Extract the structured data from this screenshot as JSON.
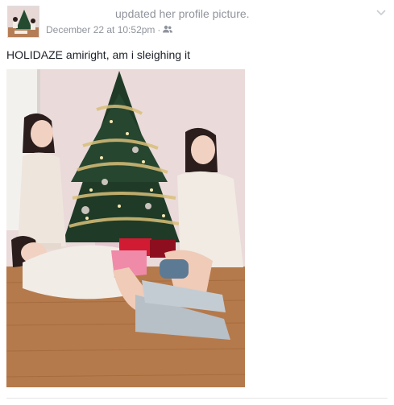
{
  "post": {
    "headline": "updated her profile picture.",
    "timestamp": "December 22 at 10:52pm",
    "separator": "·",
    "privacy_icon": "friends-icon",
    "menu_icon": "chevron-down-icon",
    "status_text": "HOLIDAZE amiright, am i sleighing it"
  },
  "colors": {
    "meta_gray": "#90949c",
    "text": "#1d2129",
    "wall": "#e9d8d8",
    "floor": "#b77a4c",
    "tree": "#1f3b27"
  }
}
